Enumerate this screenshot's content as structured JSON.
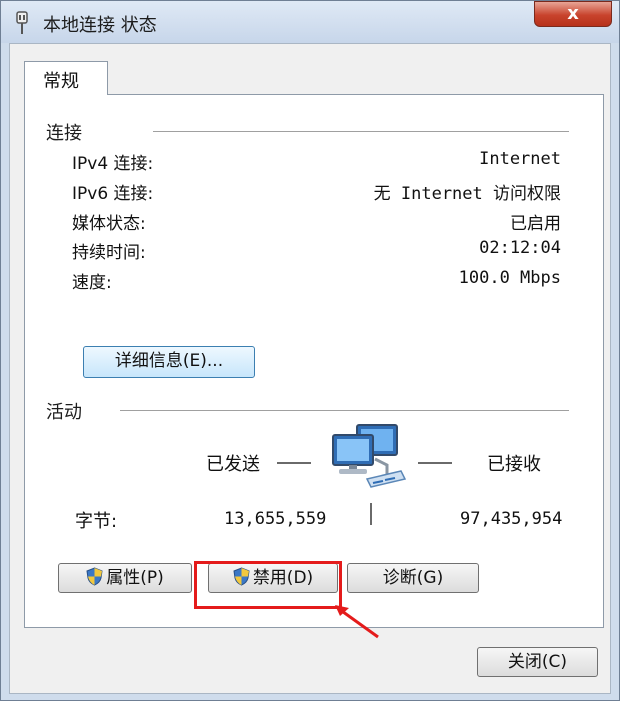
{
  "window": {
    "title": "本地连接 状态",
    "close_label": "x"
  },
  "tabs": [
    {
      "label": "常规",
      "selected": true
    }
  ],
  "connection": {
    "heading": "连接",
    "rows": [
      {
        "label": "IPv4 连接:",
        "value": "Internet"
      },
      {
        "label": "IPv6 连接:",
        "value": "无 Internet 访问权限"
      },
      {
        "label": "媒体状态:",
        "value": "已启用"
      },
      {
        "label": "持续时间:",
        "value": "02:12:04"
      },
      {
        "label": "速度:",
        "value": "100.0 Mbps"
      }
    ],
    "details_button": "详细信息(E)..."
  },
  "activity": {
    "heading": "活动",
    "sent_label": "已发送",
    "received_label": "已接收",
    "bytes_label": "字节:",
    "bytes_sent": "13,655,559",
    "bytes_received": "97,435,954"
  },
  "actions": {
    "properties": "属性(P)",
    "disable": "禁用(D)",
    "diagnose": "诊断(G)"
  },
  "footer": {
    "close": "关闭(C)"
  },
  "colors": {
    "annotation_red": "#e41b1b",
    "close_button": "#c8432c",
    "details_button_border": "#3c7fb1"
  }
}
